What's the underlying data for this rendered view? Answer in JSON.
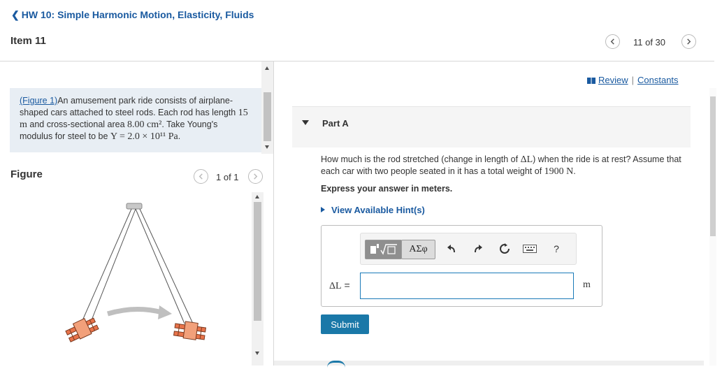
{
  "header": {
    "back_label": "HW 10: Simple Harmonic Motion, Elasticity, Fluids",
    "item_title": "Item 11",
    "item_counter": "11 of 30"
  },
  "problem": {
    "figure_link": "(Figure 1)",
    "text_1": "An amusement park ride consists of airplane-shaped cars attached to steel rods. Each rod has length ",
    "length": "15 m",
    "text_2": " and cross-sectional area ",
    "area": "8.00 cm²",
    "text_3": ". Take Young's modulus for steel to be ",
    "modulus": "Y = 2.0 × 10¹¹ Pa",
    "text_4": "."
  },
  "figure": {
    "label": "Figure",
    "counter": "1 of 1"
  },
  "links": {
    "review": "Review",
    "separator": "|",
    "constants": "Constants"
  },
  "part": {
    "title": "Part A",
    "question_1": "How much is the rod stretched (change in length of ",
    "question_var": "ΔL",
    "question_2": ") when the ride is at rest? Assume that each car with two people seated in it has a total weight of ",
    "weight": "1900 N",
    "question_3": ".",
    "instructions": "Express your answer in meters.",
    "hints_label": "View Available Hint(s)"
  },
  "answer": {
    "variable": "ΔL",
    "equals": " =",
    "value": "",
    "unit": "m",
    "greek_label": "ΑΣφ",
    "help_label": "?",
    "submit_label": "Submit"
  },
  "icons": {
    "back": "chevron-left-icon",
    "prev": "chevron-left-icon",
    "next": "chevron-right-icon",
    "review": "book-icon",
    "undo": "undo-icon",
    "redo": "redo-icon",
    "reset": "reset-icon",
    "keyboard": "keyboard-icon"
  },
  "colors": {
    "link": "#1a5aa0",
    "submit": "#1a78a8",
    "problem_bg": "#e8eef4",
    "plane": "#e8734a"
  }
}
